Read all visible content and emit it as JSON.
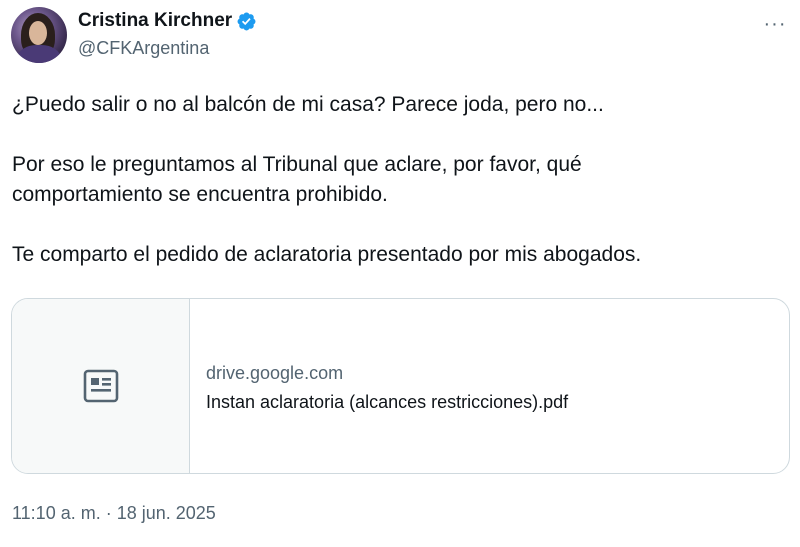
{
  "author": {
    "name": "Cristina Kirchner",
    "handle": "@CFKArgentina"
  },
  "icons": {
    "verified": "verified-badge-icon",
    "more": "more-options-icon",
    "document": "document-icon"
  },
  "colors": {
    "verified": "#1d9bf0",
    "text": "#0f1419",
    "secondary": "#536471"
  },
  "tweet": {
    "line1": "¿Puedo salir o no al balcón de mi casa? Parece joda, pero no...",
    "line2": "Por eso le preguntamos al Tribunal que aclare, por favor, qué",
    "line3": "comportamiento se encuentra prohibido.",
    "line4": "Te comparto el pedido de aclaratoria presentado por mis abogados."
  },
  "link_card": {
    "domain": "drive.google.com",
    "title": "Instan aclaratoria (alcances restricciones).pdf"
  },
  "timestamp": "11:10 a. m. · 18 jun. 2025",
  "more_label": "···"
}
